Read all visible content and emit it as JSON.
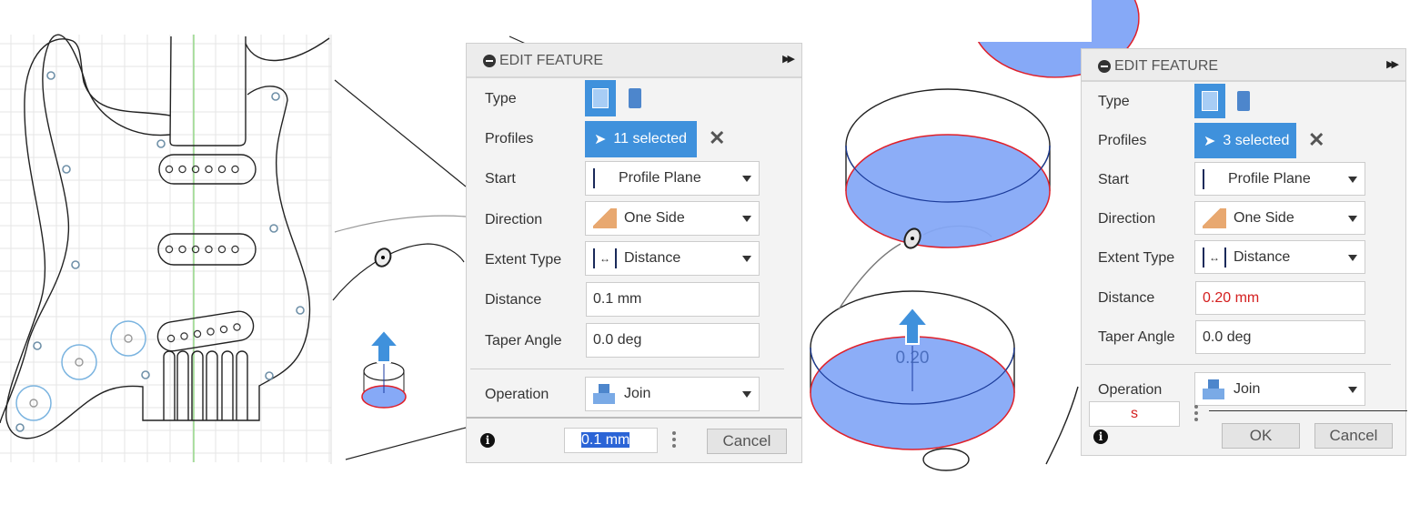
{
  "panel_sketch": {
    "description_icons": [
      "pickguard-sketch"
    ]
  },
  "viewport_left": {
    "arrow_icon": "extrude-arrow-icon"
  },
  "viewport_right": {
    "dimension_label": "0.20"
  },
  "dialog_left": {
    "title": "EDIT FEATURE",
    "type_label": "Type",
    "profiles_label": "Profiles",
    "profiles_value": "11 selected",
    "start_label": "Start",
    "start_value": "Profile Plane",
    "direction_label": "Direction",
    "direction_value": "One Side",
    "extent_label": "Extent Type",
    "extent_value": "Distance",
    "distance_label": "Distance",
    "distance_value": "0.1 mm",
    "taper_label": "Taper Angle",
    "taper_value": "0.0 deg",
    "operation_label": "Operation",
    "operation_value": "Join",
    "footer_input": "0.1 mm",
    "cancel_label": "Cancel"
  },
  "dialog_right": {
    "title": "EDIT FEATURE",
    "type_label": "Type",
    "profiles_label": "Profiles",
    "profiles_value": "3 selected",
    "start_label": "Start",
    "start_value": "Profile Plane",
    "direction_label": "Direction",
    "direction_value": "One Side",
    "extent_label": "Extent Type",
    "extent_value": "Distance",
    "distance_label": "Distance",
    "distance_value": "0.20 mm",
    "taper_label": "Taper Angle",
    "taper_value": "0.0 deg",
    "operation_label": "Operation",
    "operation_value": "Join",
    "footer_input": "s",
    "ok_label": "OK",
    "cancel_label": "Cancel"
  },
  "colors": {
    "accent": "#3f91dc",
    "profile_fill": "#86a9f7",
    "profile_edge": "#e0202a",
    "error_text": "#d42020",
    "centerline": "#7ed36f",
    "knob": "#7bb4e0"
  }
}
